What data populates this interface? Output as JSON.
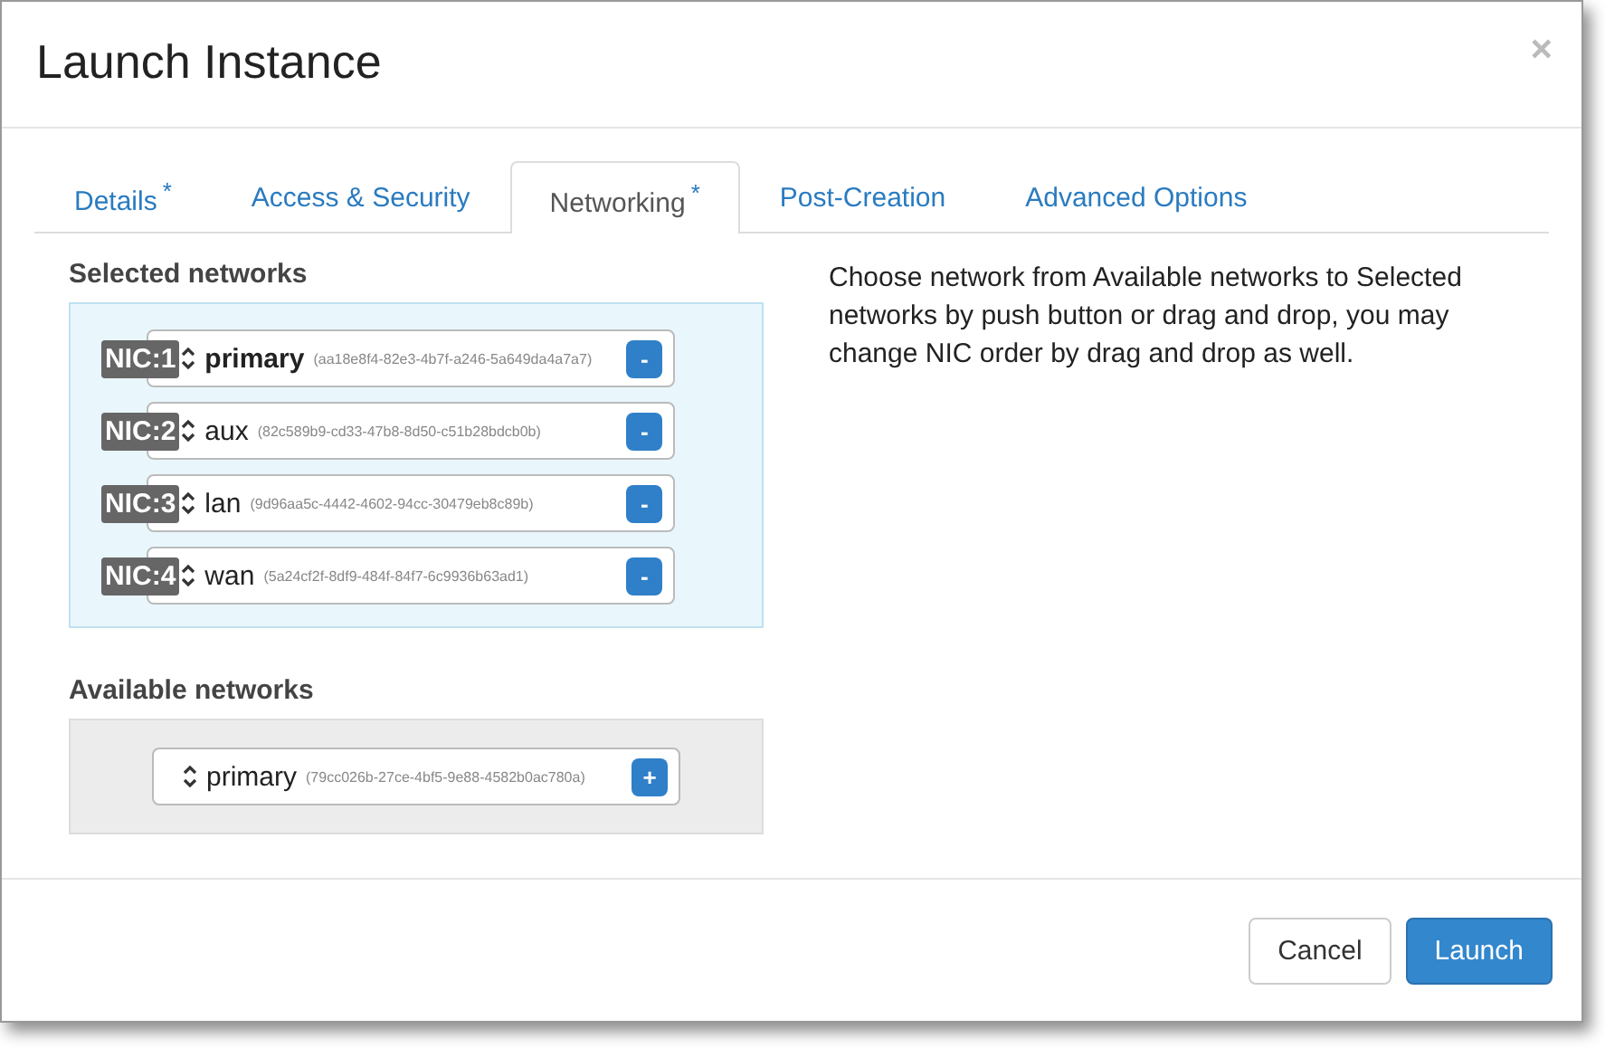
{
  "dialog": {
    "title": "Launch Instance",
    "close": "×"
  },
  "tabs": [
    {
      "label": "Details",
      "marker": "*",
      "selected": false
    },
    {
      "label": "Access & Security",
      "selected": false
    },
    {
      "label": "Networking",
      "marker": "*",
      "selected": true
    },
    {
      "label": "Post-Creation",
      "selected": false
    },
    {
      "label": "Advanced Options",
      "selected": false
    }
  ],
  "selected_networks": {
    "heading": "Selected networks",
    "items": [
      {
        "nic": "NIC:1",
        "name": "primary",
        "id": "(aa18e8f4-82e3-4b7f-a246-5a649da4a7a7)",
        "action": "-"
      },
      {
        "nic": "NIC:2",
        "name": "aux",
        "id": "(82c589b9-cd33-47b8-8d50-c51b28bdcb0b)",
        "action": "-"
      },
      {
        "nic": "NIC:3",
        "name": "lan",
        "id": "(9d96aa5c-4442-4602-94cc-30479eb8c89b)",
        "action": "-"
      },
      {
        "nic": "NIC:4",
        "name": "wan",
        "id": "(5a24cf2f-8df9-484f-84f7-6c9936b63ad1)",
        "action": "-"
      }
    ]
  },
  "available_networks": {
    "heading": "Available networks",
    "items": [
      {
        "name": "primary",
        "id": "(79cc026b-27ce-4bf5-9e88-4582b0ac780a)",
        "action": "+"
      }
    ]
  },
  "help_text": "Choose network from Available networks to Selected networks by push button or drag and drop, you may change NIC order by drag and drop as well.",
  "buttons": [
    {
      "label": "Cancel",
      "kind": "default"
    },
    {
      "label": "Launch",
      "kind": "primary"
    }
  ]
}
